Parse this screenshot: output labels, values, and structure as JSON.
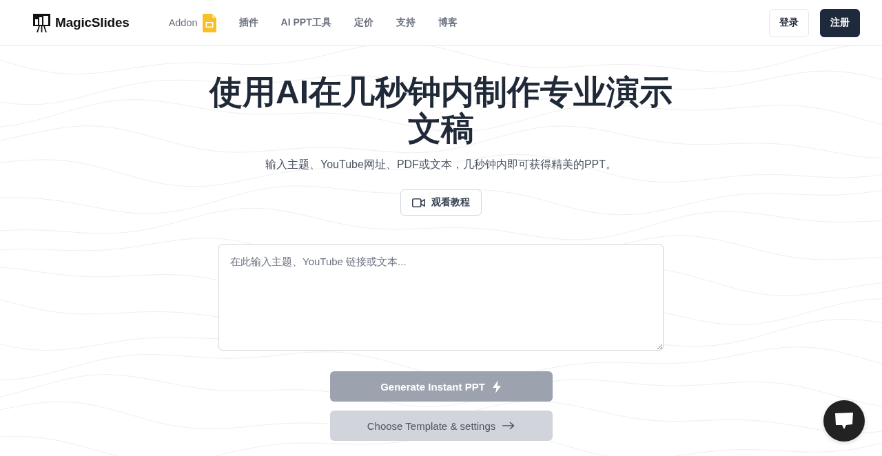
{
  "header": {
    "logo": {
      "text": "MagicSlides"
    },
    "nav": [
      {
        "label": "Addon",
        "kind": "addon"
      },
      {
        "label": "插件",
        "kind": "link"
      },
      {
        "label": "AI PPT工具",
        "kind": "link"
      },
      {
        "label": "定价",
        "kind": "link"
      },
      {
        "label": "支持",
        "kind": "link"
      },
      {
        "label": "博客",
        "kind": "link"
      }
    ],
    "buttons": [
      {
        "label": "登录",
        "kind": "outline"
      },
      {
        "label": "注册",
        "kind": "solid"
      }
    ]
  },
  "hero": {
    "title": "使用AI在几秒钟内制作专业演示文稿",
    "subtitle": "输入主题、YouTube网址、PDF或文本，几秒钟内即可获得精美的PPT。",
    "tutorial_button": {
      "label": "观看教程"
    }
  },
  "prompt": {
    "placeholder": "在此输入主题、YouTube 链接或文本..."
  },
  "actions": [
    {
      "label": "Generate Instant PPT",
      "kind": "generate",
      "disabled": true
    },
    {
      "label": "Choose Template & settings",
      "kind": "template",
      "disabled": true
    }
  ]
}
